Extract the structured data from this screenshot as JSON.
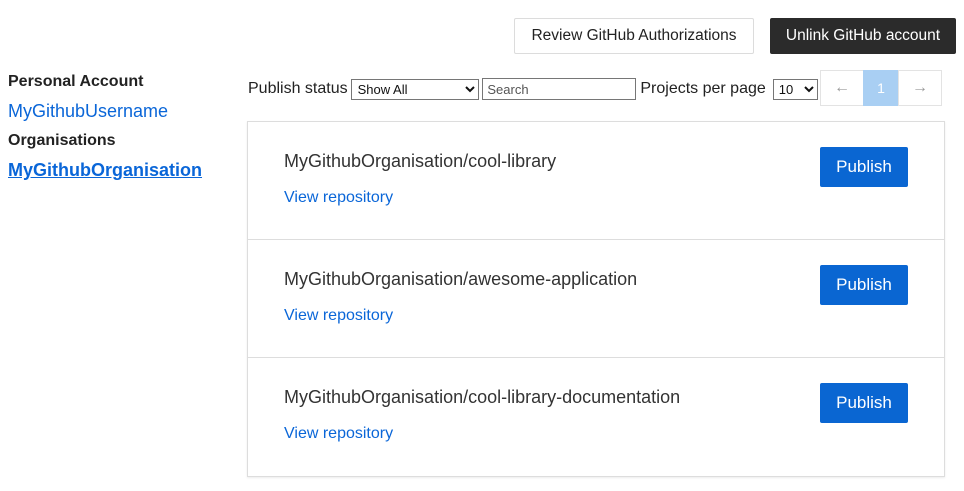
{
  "header": {
    "review_label": "Review GitHub Authorizations",
    "unlink_label": "Unlink GitHub account"
  },
  "sidebar": {
    "personal_heading": "Personal Account",
    "personal_user": "MyGithubUsername",
    "organisations_heading": "Organisations",
    "organisations": [
      "MyGithubOrganisation"
    ],
    "active_organisation": "MyGithubOrganisation"
  },
  "filters": {
    "publish_status_label": "Publish status",
    "publish_status_value": "Show All",
    "search_placeholder": "Search",
    "per_page_label": "Projects per page",
    "per_page_value": "10"
  },
  "pagination": {
    "prev_icon": "arrow-left",
    "prev_glyph": "←",
    "current_page": "1",
    "next_icon": "arrow-right",
    "next_glyph": "→"
  },
  "repositories": [
    {
      "name": "MyGithubOrganisation/cool-library",
      "link_label": "View repository",
      "publish_label": "Publish"
    },
    {
      "name": "MyGithubOrganisation/awesome-application",
      "link_label": "View repository",
      "publish_label": "Publish"
    },
    {
      "name": "MyGithubOrganisation/cool-library-documentation",
      "link_label": "View repository",
      "publish_label": "Publish"
    }
  ],
  "colors": {
    "link": "#0a66d8",
    "primary": "#0a66d2",
    "dark_button": "#2b2b2b",
    "page_current": "#a9cff3"
  }
}
